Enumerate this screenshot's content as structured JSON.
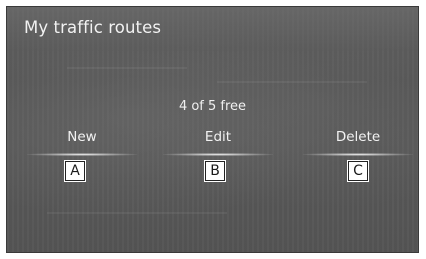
{
  "header": {
    "title": "My traffic routes"
  },
  "status": {
    "free_count": "4 of 5 free"
  },
  "actions": [
    {
      "label": "New"
    },
    {
      "label": "Edit"
    },
    {
      "label": "Delete"
    }
  ],
  "callouts": [
    "A",
    "B",
    "C"
  ],
  "colors": {
    "screen_background": "#595959",
    "text": "#f2f2f2",
    "callout_border": "#222222",
    "callout_background": "#ffffff"
  }
}
